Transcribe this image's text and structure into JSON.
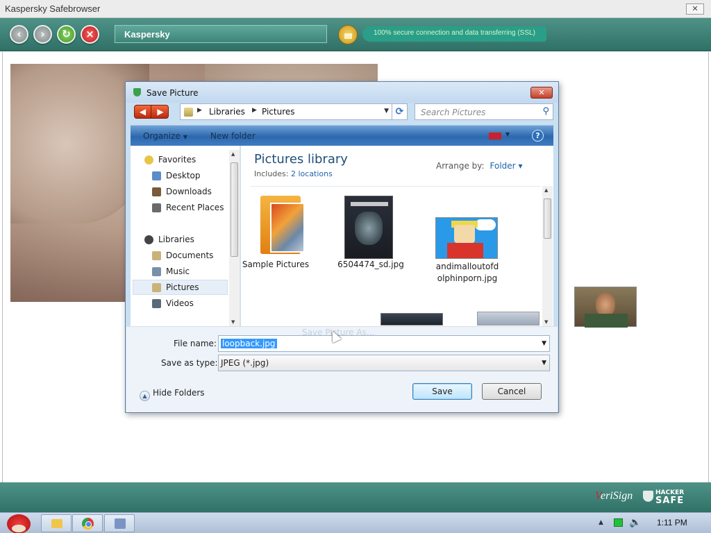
{
  "browser": {
    "title": "Kaspersky Safebrowser",
    "close_label": "✕",
    "address": "Kaspersky",
    "ssl_text": "100% secure connection and data transferring (SSL)"
  },
  "footer": {
    "verisign": "VeriSign",
    "hacker": "HACKER",
    "safe": "SAFE"
  },
  "taskbar": {
    "clock": "1:11 PM"
  },
  "dialog": {
    "title": "Save Picture",
    "breadcrumb": [
      "Libraries",
      "Pictures"
    ],
    "search_placeholder": "Search Pictures",
    "organize": "Organize",
    "new_folder": "New folder",
    "help": "?",
    "nav": {
      "favorites": "Favorites",
      "desktop": "Desktop",
      "downloads": "Downloads",
      "recent": "Recent Places",
      "libraries": "Libraries",
      "documents": "Documents",
      "music": "Music",
      "pictures": "Pictures",
      "videos": "Videos"
    },
    "library_title": "Pictures library",
    "includes_label": "Includes:",
    "includes_link": "2 locations",
    "arrange_label": "Arrange by:",
    "arrange_value": "Folder",
    "files": {
      "f1": "Sample Pictures",
      "f2": "6504474_sd.jpg",
      "f3a": "andimalloutofd",
      "f3b": "olphinporn.jpg"
    },
    "file_name_label": "File name:",
    "file_name_value": "loopback.jpg",
    "save_type_label": "Save as type:",
    "save_type_value": "JPEG (*.jpg)",
    "hide_folders": "Hide Folders",
    "save_button": "Save",
    "cancel_button": "Cancel",
    "ghost_text": "Save Picture As..."
  }
}
